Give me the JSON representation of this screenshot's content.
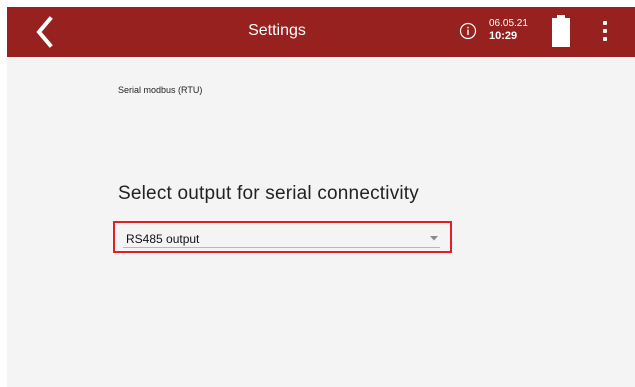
{
  "header": {
    "title": "Settings",
    "date": "06.05.21",
    "time": "10:29",
    "icons": {
      "back": "chevron-left-icon",
      "info": "info-icon",
      "battery": "battery-icon",
      "menu": "more-vertical-icon"
    }
  },
  "main": {
    "section_label": "Serial modbus (RTU)",
    "heading": "Select output for serial connectivity",
    "output_select": {
      "value": "RS485 output"
    }
  },
  "colors": {
    "header_bg": "#96211f",
    "highlight_border": "#e31e24",
    "background": "#f4f4f4"
  }
}
